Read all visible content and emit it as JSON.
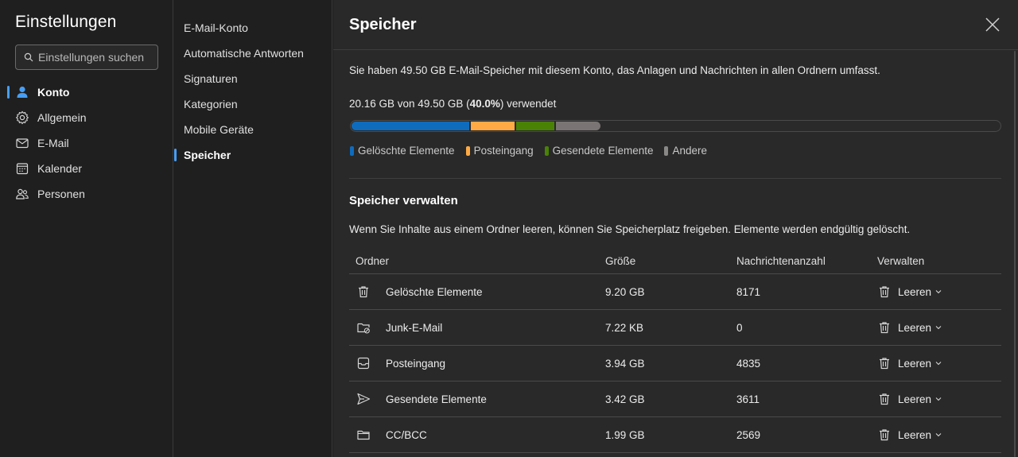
{
  "app": {
    "title": "Einstellungen"
  },
  "search": {
    "placeholder": "Einstellungen suchen"
  },
  "nav": [
    {
      "label": "Konto",
      "icon": "person-icon",
      "active": true
    },
    {
      "label": "Allgemein",
      "icon": "gear-icon",
      "active": false
    },
    {
      "label": "E-Mail",
      "icon": "mail-icon",
      "active": false
    },
    {
      "label": "Kalender",
      "icon": "calendar-icon",
      "active": false
    },
    {
      "label": "Personen",
      "icon": "people-icon",
      "active": false
    }
  ],
  "subnav": [
    {
      "label": "E-Mail-Konto",
      "active": false
    },
    {
      "label": "Automatische Antworten",
      "active": false
    },
    {
      "label": "Signaturen",
      "active": false
    },
    {
      "label": "Kategorien",
      "active": false
    },
    {
      "label": "Mobile Geräte",
      "active": false
    },
    {
      "label": "Speicher",
      "active": true
    }
  ],
  "panel": {
    "title": "Speicher",
    "intro": "Sie haben 49.50 GB E-Mail-Speicher mit diesem Konto, das Anlagen und Nachrichten in allen Ordnern umfasst.",
    "usage_prefix": "20.16 GB von 49.50 GB (",
    "usage_percent": "40.0%",
    "usage_suffix": ") verwendet",
    "bar_segments": [
      {
        "name": "Gelöschte Elemente",
        "fraction": 0.182,
        "color": "#0f6cbd"
      },
      {
        "name": "Posteingang",
        "fraction": 0.068,
        "color": "#ffaa44"
      },
      {
        "name": "Gesendete Elemente",
        "fraction": 0.059,
        "color": "#498205"
      },
      {
        "name": "Andere",
        "fraction": 0.069,
        "color": "#7a7574"
      }
    ],
    "legend": [
      {
        "label": "Gelöschte Elemente",
        "color": "#0f6cbd"
      },
      {
        "label": "Posteingang",
        "color": "#ffaa44"
      },
      {
        "label": "Gesendete Elemente",
        "color": "#498205"
      },
      {
        "label": "Andere",
        "color": "#8a8886"
      }
    ],
    "manage_title": "Speicher verwalten",
    "manage_desc": "Wenn Sie Inhalte aus einem Ordner leeren, können Sie Speicherplatz freigeben. Elemente werden endgültig gelöscht.",
    "table": {
      "headers": {
        "folder": "Ordner",
        "size": "Größe",
        "count": "Nachrichtenanzahl",
        "manage": "Verwalten"
      },
      "rows": [
        {
          "icon": "trash-icon",
          "folder": "Gelöschte Elemente",
          "size": "9.20 GB",
          "count": "8171",
          "action": "Leeren"
        },
        {
          "icon": "junk-folder-icon",
          "folder": "Junk-E-Mail",
          "size": "7.22 KB",
          "count": "0",
          "action": "Leeren"
        },
        {
          "icon": "inbox-icon",
          "folder": "Posteingang",
          "size": "3.94 GB",
          "count": "4835",
          "action": "Leeren"
        },
        {
          "icon": "send-icon",
          "folder": "Gesendete Elemente",
          "size": "3.42 GB",
          "count": "3611",
          "action": "Leeren"
        },
        {
          "icon": "folder-icon",
          "folder": "CC/BCC",
          "size": "1.99 GB",
          "count": "2569",
          "action": "Leeren"
        }
      ]
    }
  }
}
